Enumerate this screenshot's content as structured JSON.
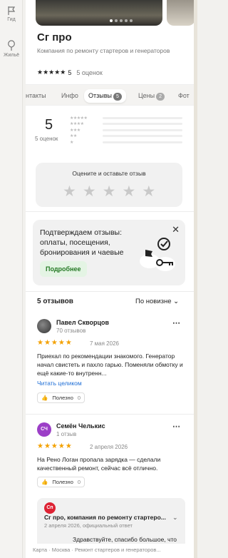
{
  "sidebar": {
    "guide_label": "Гид",
    "housing_label": "Жильё"
  },
  "org": {
    "name": "Сг про",
    "description": "Компания по ремонту стартеров и генераторов",
    "rating_stars": "★★★★★",
    "rating_value": "5",
    "rating_count": "5 оценок"
  },
  "tabs": [
    {
      "label": "нтакты"
    },
    {
      "label": "Инфо"
    },
    {
      "label": "Отзывы",
      "badge": "5"
    },
    {
      "label": "Цены",
      "badge": "2"
    },
    {
      "label": "Фот"
    }
  ],
  "summary": {
    "score": "5",
    "count": "5 оценок",
    "rate_prompt": "Оцените и оставьте отзыв",
    "empty_stars": [
      "★",
      "★",
      "★",
      "★",
      "★"
    ],
    "bar_star_rows": [
      "★★★★★",
      "★★★★",
      "★★★",
      "★★",
      "★"
    ]
  },
  "promo": {
    "text": "Подтверждаем отзывы: оплаты, посещения, бронирования и чаевые",
    "button": "Подробнее",
    "close": "✕"
  },
  "reviews_header": {
    "count_label": "5 отзывов",
    "sort_label": "По новизне"
  },
  "reviews": [
    {
      "name": "Павел Скворцов",
      "subtitle": "70 отзывов",
      "stars": "★★★★★",
      "date": "7 мая 2026",
      "text": "Приехал по рекомендации знакомого. Генератор начал свистеть и пахло гарью. Поменяли обмотку и ещё какие-то внутренн...",
      "read_more": "Читать целиком",
      "useful_label": "Полезно",
      "useful_count": "0"
    },
    {
      "initials": "СЧ",
      "name": "Семён Челькис",
      "subtitle": "1 отзыв",
      "stars": "★★★★★",
      "date": "2 апреля 2026",
      "text": "На Рено Логан пропала зарядка — сделали качественный ремонт, сейчас всё отлично.",
      "useful_label": "Полезно",
      "useful_count": "0"
    }
  ],
  "reply": {
    "initials": "Сп",
    "name": "Сг про, компания по ремонту стартеро...",
    "date": "2 апреля 2026, официальный ответ",
    "text": "Здравствуйте, спасибо большое, что",
    "more": "⌄"
  },
  "footer": {
    "breadcrumb": "Карта · Москва · Ремонт стартеров и генераторов..."
  },
  "colors": {
    "accent_star": "#f3a100",
    "avatar_purple": "#9c3fc7",
    "reply_red": "#dd2233",
    "link": "#1e6ed6"
  }
}
